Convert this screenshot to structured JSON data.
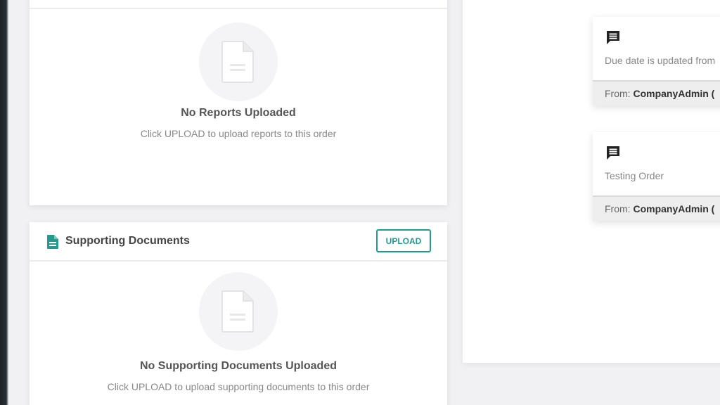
{
  "reports": {
    "empty_title": "No Reports Uploaded",
    "empty_subtitle": "Click UPLOAD to upload reports to this order",
    "icon": "document-icon"
  },
  "supporting_documents": {
    "title": "Supporting Documents",
    "upload_label": "UPLOAD",
    "empty_title": "No Supporting Documents Uploaded",
    "empty_subtitle": "Click UPLOAD to upload supporting documents to this order",
    "header_icon": "file-icon",
    "icon": "document-icon"
  },
  "activity": {
    "notes": [
      {
        "icon": "comment-icon",
        "text": "Due date is updated from",
        "from_label": "From:",
        "from_value": "CompanyAdmin ("
      },
      {
        "icon": "comment-icon",
        "text": "Testing Order",
        "from_label": "From:",
        "from_value": "CompanyAdmin ("
      }
    ]
  },
  "colors": {
    "accent": "#239a8c",
    "background": "#f1f1f3",
    "card": "#ffffff"
  }
}
